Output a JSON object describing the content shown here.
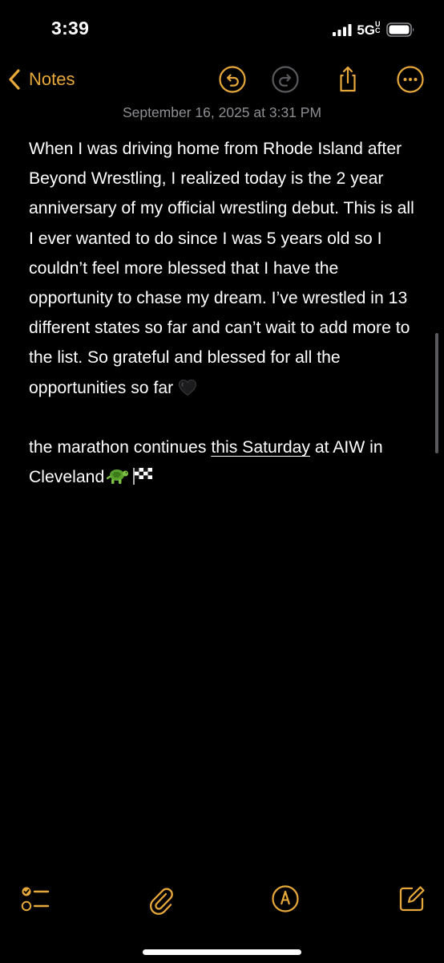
{
  "status_bar": {
    "time": "3:39",
    "network": "5G",
    "network_suffix": "UC"
  },
  "nav": {
    "back_label": "Notes",
    "accent_color": "#e7a83b",
    "icons": [
      "chevron-left-icon",
      "undo-icon",
      "redo-icon",
      "share-icon",
      "more-icon"
    ]
  },
  "note": {
    "date": "September 16, 2025 at 3:31 PM",
    "paragraph1": "When I was driving home from Rhode Island after Beyond Wrestling, I realized today is the 2 year anniversary of my official wrestling debut. This is all I ever wanted to do since I was 5 years old so I couldn’t feel more blessed that I have the opportunity to chase my dream. I’ve wrestled in 13 different states so far and can’t wait to add more to the list. So grateful and blessed for all the opportunities so far",
    "paragraph1_emoji": "black-heart",
    "paragraph2_before": "the marathon continues ",
    "paragraph2_link": "this Saturday",
    "paragraph2_after": " at AIW in Cleveland",
    "paragraph2_emojis": [
      "turtle",
      "checkered-flag"
    ]
  },
  "toolbar": {
    "icons": [
      "checklist-icon",
      "paperclip-icon",
      "markup-pen-icon",
      "compose-icon"
    ]
  }
}
